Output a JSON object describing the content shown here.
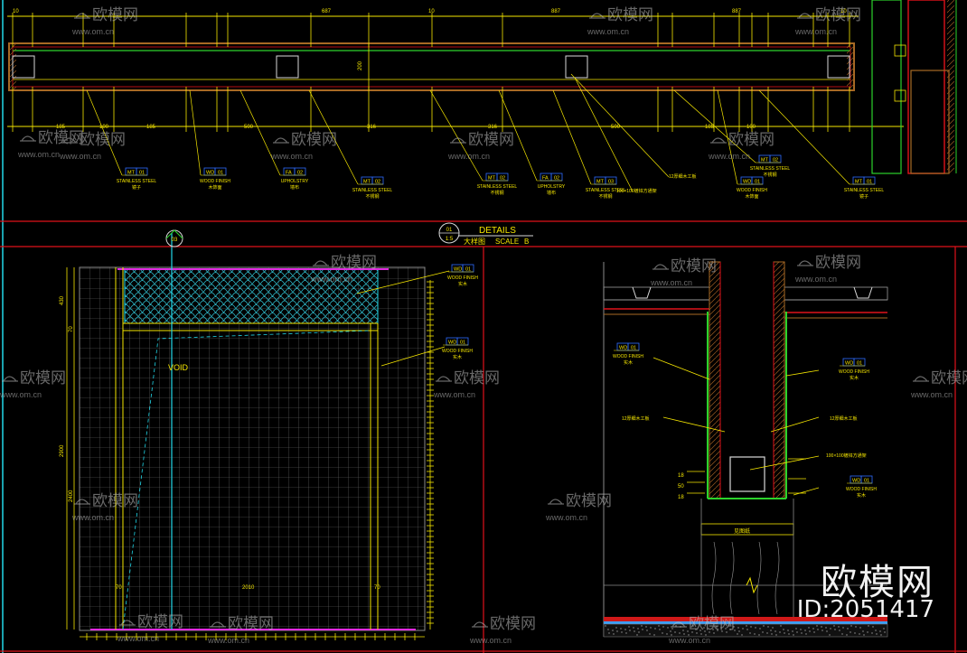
{
  "header": {
    "detail_title": "DETAILS",
    "detail_subtitle": "大样图",
    "scale_label": "SCALE",
    "scale_value": "B",
    "callout_top": "01",
    "callout_bottom": "1:5",
    "section_marker": "03"
  },
  "top_elevation": {
    "top_dims": [
      "10",
      "687",
      "10",
      "887",
      "887",
      "10"
    ],
    "depth_dim": "200",
    "bottom_dims": [
      "185",
      "100",
      "185",
      "500",
      "316",
      "316",
      "500",
      "185",
      "100"
    ],
    "tags": [
      {
        "code": "MT",
        "num": "01",
        "name": "STAINLESS STEEL",
        "cn": "镜子"
      },
      {
        "code": "WD",
        "num": "01",
        "name": "WOOD FINISH",
        "cn": "木饰面"
      },
      {
        "code": "FA",
        "num": "02",
        "name": "UPHOLSTRY",
        "cn": "墙布"
      },
      {
        "code": "MT",
        "num": "02",
        "name": "STAINLESS STEEL",
        "cn": "不锈钢"
      },
      {
        "code": "MT",
        "num": "02",
        "name": "STAINLESS STEEL",
        "cn": "不锈钢"
      },
      {
        "code": "FA",
        "num": "02",
        "name": "UPHOLSTRY",
        "cn": "墙布"
      },
      {
        "code": "MT",
        "num": "03",
        "name": "STAINLESS STEEL",
        "cn": "不锈钢"
      },
      {
        "code": "MT",
        "num": "02",
        "name": "STAINLESS STEEL",
        "cn": "不锈钢"
      },
      {
        "code": "WD",
        "num": "01",
        "name": "WOOD FINISH",
        "cn": "木饰面"
      },
      {
        "code": "MT",
        "num": "01",
        "name": "STAINLESS STEEL",
        "cn": "镜子"
      }
    ],
    "notes": [
      "12厚细木工板",
      "100×100镀锌方通架"
    ]
  },
  "left_elevation": {
    "void_label": "VOID",
    "vertical_dims": [
      "430",
      "70",
      "2400",
      "2900"
    ],
    "horizontal_dims": [
      "70",
      "2010",
      "70"
    ],
    "bottom_grid_unit": "100",
    "tags": [
      {
        "code": "WD",
        "num": "01",
        "name": "WOOD FINISH",
        "cn": "实木"
      },
      {
        "code": "WD",
        "num": "01",
        "name": "WOOD FINISH",
        "cn": "实木"
      }
    ]
  },
  "right_section": {
    "dims": [
      "18",
      "50",
      "18"
    ],
    "base_label": "见图纸",
    "tags": [
      {
        "code": "WD",
        "num": "01",
        "name": "WOOD FINISH",
        "cn": "实木"
      },
      {
        "code": "WD",
        "num": "01",
        "name": "WOOD FINISH",
        "cn": "实木"
      },
      {
        "code": "WD",
        "num": "01",
        "name": "WOOD FINISH",
        "cn": "实木"
      }
    ],
    "notes": [
      "12厚细木工板",
      "12厚细木工板",
      "100×100镀锌方通架"
    ]
  },
  "watermark": {
    "brand_cn": "欧模网",
    "site": "www.om.cn",
    "id_text": "ID:2051417"
  },
  "colors": {
    "background": "#000000",
    "frame_red": "#e0121a",
    "cad_yellow": "#f5e600",
    "cad_green": "#2cd32c",
    "cad_cyan": "#22d7e8",
    "cad_magenta": "#e12ae0",
    "cad_brown": "#a86a24",
    "cad_gray": "#8a8a8a"
  }
}
